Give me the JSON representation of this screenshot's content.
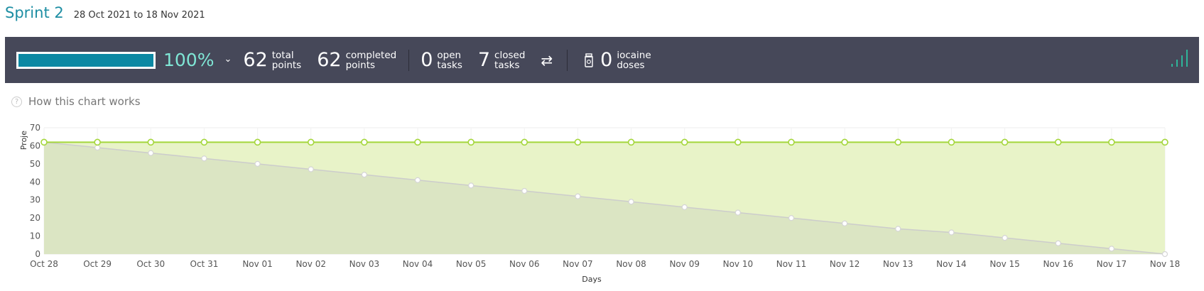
{
  "sprint": {
    "title": "Sprint 2",
    "dates": "28 Oct 2021 to 18 Nov 2021"
  },
  "summary": {
    "progress_fraction": 1.0,
    "percent_label": "100%",
    "total_points": "62",
    "total_points_label_1": "total",
    "total_points_label_2": "points",
    "completed_points": "62",
    "completed_points_label_1": "completed",
    "completed_points_label_2": "points",
    "open_tasks": "0",
    "open_tasks_label_1": "open",
    "open_tasks_label_2": "tasks",
    "closed_tasks": "7",
    "closed_tasks_label_1": "closed",
    "closed_tasks_label_2": "tasks",
    "iocaine_doses": "0",
    "iocaine_label_1": "iocaine",
    "iocaine_label_2": "doses",
    "icons": [
      "chevron-down-icon",
      "swap-arrows-icon",
      "potion-jar-icon",
      "signal-bars-icon"
    ]
  },
  "help": {
    "label": "How this chart works"
  },
  "colors": {
    "accent": "#1d8ea3",
    "bar_bg": "#464859",
    "progress": "#0c88a3",
    "percent_text": "#7fe6d5",
    "line_green": "#a4d63b",
    "fill_green": "#e8f3c8",
    "fill_grey": "#dbe5c3",
    "line_grey": "#cccccc"
  },
  "chart_data": {
    "type": "area",
    "xlabel": "Days",
    "ylabel": "Proje",
    "ylim": [
      0,
      70
    ],
    "yticks": [
      0,
      10,
      20,
      30,
      40,
      50,
      60,
      70
    ],
    "categories": [
      "Oct 28",
      "Oct 29",
      "Oct 30",
      "Oct 31",
      "Nov 01",
      "Nov 02",
      "Nov 03",
      "Nov 04",
      "Nov 05",
      "Nov 06",
      "Nov 07",
      "Nov 08",
      "Nov 09",
      "Nov 10",
      "Nov 11",
      "Nov 12",
      "Nov 13",
      "Nov 14",
      "Nov 15",
      "Nov 16",
      "Nov 17",
      "Nov 18"
    ],
    "grid": true,
    "series": [
      {
        "values": [
          62,
          62,
          62,
          62,
          62,
          62,
          62,
          62,
          62,
          62,
          62,
          62,
          62,
          62,
          62,
          62,
          62,
          62,
          62,
          62,
          62,
          62
        ]
      },
      {
        "values": [
          62,
          59,
          56,
          53,
          50,
          47,
          44,
          41,
          38,
          35,
          32,
          29,
          26,
          23,
          20,
          17,
          14,
          12,
          9,
          6,
          3,
          0
        ]
      }
    ]
  }
}
